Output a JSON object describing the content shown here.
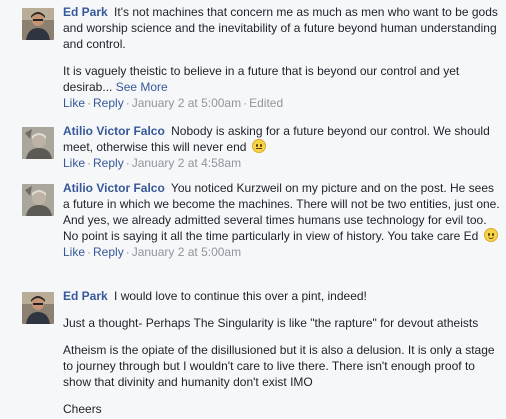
{
  "comments": [
    {
      "author": "Ed Park",
      "avatar_icon": "profile-photo-ed-park",
      "paragraphs": [
        "It's not machines that concern me as much as men who want to be gods and worship science and the inevitability of a future beyond human understanding and control.",
        "It is vaguely theistic to believe in a future that is beyond our control and yet desirab..."
      ],
      "see_more": "See More",
      "like": "Like",
      "reply": "Reply",
      "date": "January 2 at 5:00am",
      "edited": "Edited"
    },
    {
      "author": "Atilio Victor Falco",
      "avatar_icon": "profile-photo-atilio-falco",
      "text": "Nobody is asking for a future beyond our control. We should meet, otherwise this will never end",
      "emoji": "neutral-face-emoji",
      "like": "Like",
      "reply": "Reply",
      "date": "January 2 at 4:58am"
    },
    {
      "author": "Atilio Victor Falco",
      "avatar_icon": "profile-photo-atilio-falco",
      "text": "You noticed Kurzweil on my picture and on the post. He sees a future in which we become the machines. There will not be two entities, just one. And yes, we already admitted several times humans use technology for evil too. No point is saying it all the time particularly in view of history. You take care Ed",
      "emoji": "smile-emoji",
      "like": "Like",
      "reply": "Reply",
      "date": "January 2 at 5:00am"
    },
    {
      "author": "Ed Park",
      "avatar_icon": "profile-photo-ed-park",
      "text": "I would love to continue this over a pint, indeed!",
      "paragraphs": [
        "Just a thought- Perhaps The Singularity is like \"the rapture\" for devout atheists",
        "Atheism is the opiate of the disillusioned but it is also a delusion. It is only a stage to journey through but I wouldn't care to live there. There isn't enough proof to show that divinity and humanity don't exist IMO",
        "Cheers"
      ]
    }
  ],
  "colors": {
    "link": "#365899",
    "meta": "#90949c",
    "text": "#1d2129",
    "background": "#f6f7f9"
  }
}
